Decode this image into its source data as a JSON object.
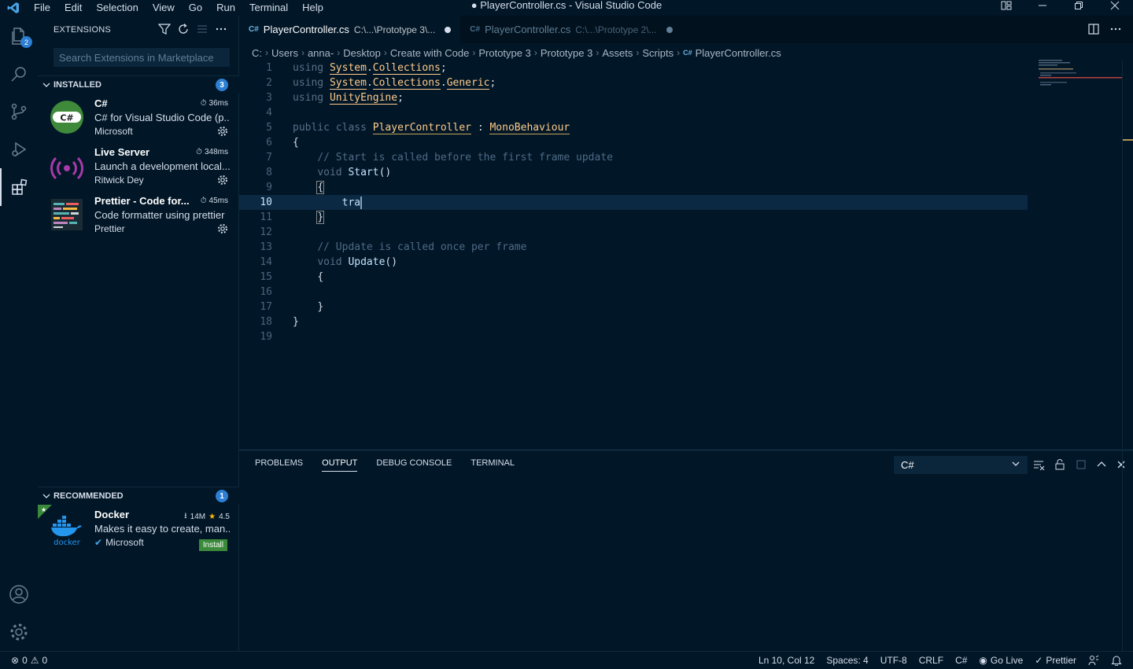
{
  "window": {
    "title": "● PlayerController.cs - Visual Studio Code",
    "menu": [
      "File",
      "Edit",
      "Selection",
      "View",
      "Go",
      "Run",
      "Terminal",
      "Help"
    ]
  },
  "activity": {
    "explorer_badge": "2",
    "items": [
      "explorer-icon",
      "search-icon",
      "source-control-icon",
      "run-debug-icon",
      "extensions-icon",
      "account-icon",
      "settings-gear-icon"
    ]
  },
  "sidebar": {
    "title": "EXTENSIONS",
    "search_placeholder": "Search Extensions in Marketplace",
    "installed": {
      "label": "INSTALLED",
      "count": "3",
      "items": [
        {
          "name": "C#",
          "time": "36ms",
          "desc": "C# for Visual Studio Code (p...",
          "publisher": "Microsoft"
        },
        {
          "name": "Live Server",
          "time": "348ms",
          "desc": "Launch a development local...",
          "publisher": "Ritwick Dey"
        },
        {
          "name": "Prettier - Code for...",
          "time": "45ms",
          "desc": "Code formatter using prettier",
          "publisher": "Prettier"
        }
      ]
    },
    "recommended": {
      "label": "RECOMMENDED",
      "count": "1",
      "items": [
        {
          "name": "Docker",
          "downloads": "14M",
          "rating": "4.5",
          "desc": "Makes it easy to create, man...",
          "publisher": "Microsoft",
          "install_label": "Install",
          "icon_text": "docker"
        }
      ]
    }
  },
  "tabs": [
    {
      "file": "PlayerController.cs",
      "path": "C:\\...\\Prototype 3\\...",
      "active": true
    },
    {
      "file": "PlayerController.cs",
      "path": "C:\\...\\Prototype 2\\...",
      "active": false
    }
  ],
  "breadcrumb": [
    "C:",
    "Users",
    "anna-",
    "Desktop",
    "Create with Code",
    "Prototype 3",
    "Prototype 3",
    "Assets",
    "Scripts",
    "PlayerController.cs"
  ],
  "editor": {
    "line_numbers": [
      "1",
      "2",
      "3",
      "4",
      "5",
      "6",
      "7",
      "8",
      "9",
      "10",
      "11",
      "12",
      "13",
      "14",
      "15",
      "16",
      "17",
      "18",
      "19"
    ],
    "current_line": "10",
    "lines": {
      "l1_kw": "using",
      "l1_a": "System",
      "l1_b": "Collections",
      "l2_kw": "using",
      "l2_a": "System",
      "l2_b": "Collections",
      "l2_c": "Generic",
      "l3_kw": "using",
      "l3_a": "UnityEngine",
      "l5_kw1": "public",
      "l5_kw2": "class",
      "l5_name": "PlayerController",
      "l5_colon": ":",
      "l5_base": "MonoBehaviour",
      "l6": "{",
      "l7": "// Start is called before the first frame update",
      "l8_kw": "void",
      "l8_fn": "Start",
      "l9": "{",
      "l10": "tra",
      "l11": "}",
      "l13": "// Update is called once per frame",
      "l14_kw": "void",
      "l14_fn": "Update",
      "l15": "{",
      "l17": "}",
      "l18": "}"
    }
  },
  "panel": {
    "tabs": [
      "PROBLEMS",
      "OUTPUT",
      "DEBUG CONSOLE",
      "TERMINAL"
    ],
    "active_tab": "OUTPUT",
    "output_channel": "C#"
  },
  "status": {
    "errors": "0",
    "warnings": "0",
    "position": "Ln 10, Col 12",
    "spaces": "Spaces: 4",
    "encoding": "UTF-8",
    "eol": "CRLF",
    "language": "C#",
    "go_live": "Go Live",
    "prettier": "Prettier"
  }
}
